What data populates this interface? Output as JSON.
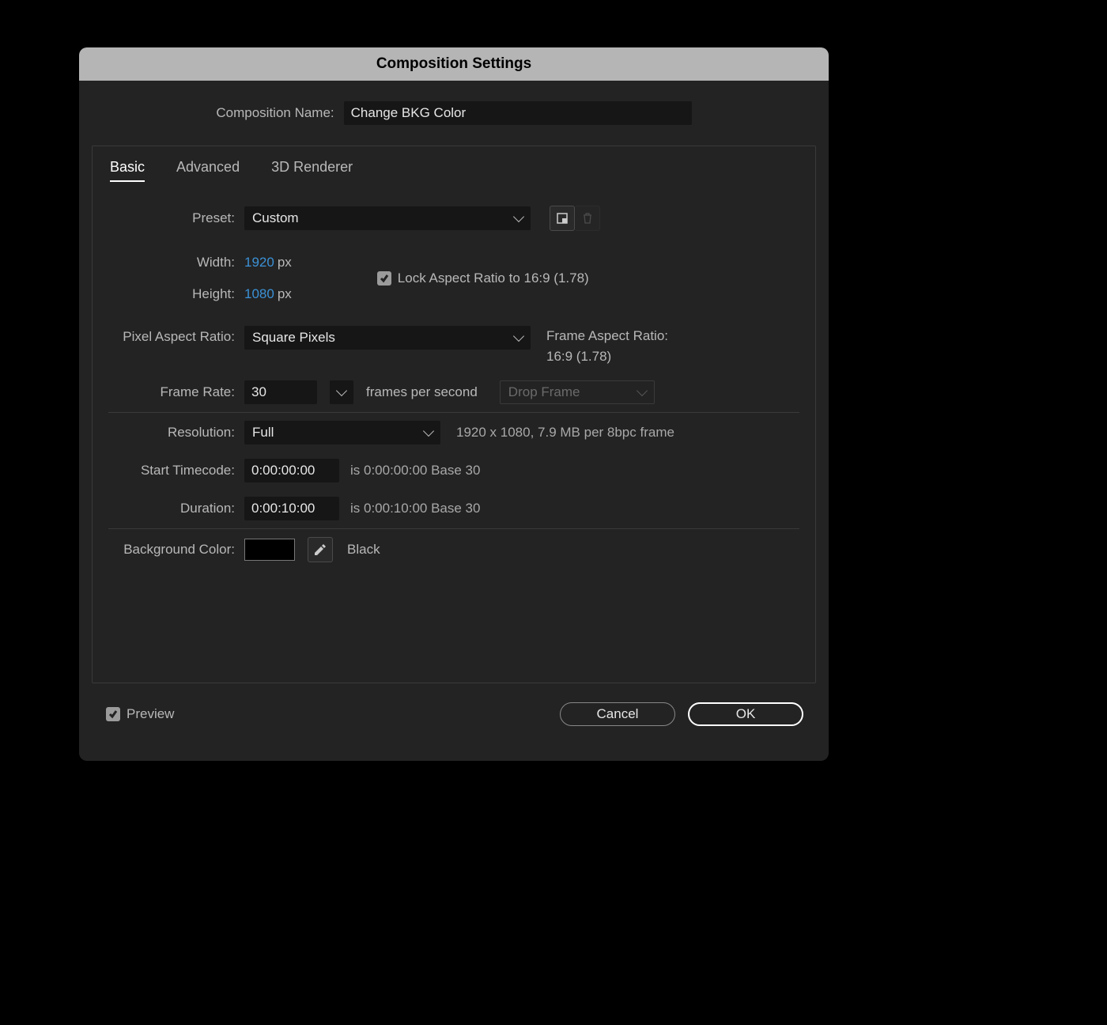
{
  "dialog": {
    "title": "Composition Settings",
    "name_label": "Composition Name:",
    "name_value": "Change BKG Color"
  },
  "tabs": {
    "basic": "Basic",
    "advanced": "Advanced",
    "renderer": "3D Renderer"
  },
  "preset": {
    "label": "Preset:",
    "value": "Custom"
  },
  "dimensions": {
    "width_label": "Width:",
    "width_value": "1920",
    "height_label": "Height:",
    "height_value": "1080",
    "unit": "px",
    "lock_label": "Lock Aspect Ratio to 16:9 (1.78)"
  },
  "par": {
    "label": "Pixel Aspect Ratio:",
    "value": "Square Pixels",
    "far_label": "Frame Aspect Ratio:",
    "far_value": "16:9 (1.78)"
  },
  "frame_rate": {
    "label": "Frame Rate:",
    "value": "30",
    "fps_label": "frames per second",
    "drop": "Drop Frame"
  },
  "resolution": {
    "label": "Resolution:",
    "value": "Full",
    "hint": "1920 x 1080, 7.9 MB per 8bpc frame"
  },
  "start_tc": {
    "label": "Start Timecode:",
    "value": "0:00:00:00",
    "hint": "is 0:00:00:00  Base 30"
  },
  "duration": {
    "label": "Duration:",
    "value": "0:00:10:00",
    "hint": "is 0:00:10:00  Base 30"
  },
  "bg": {
    "label": "Background Color:",
    "color": "#000000",
    "color_name": "Black"
  },
  "footer": {
    "preview": "Preview",
    "cancel": "Cancel",
    "ok": "OK"
  }
}
